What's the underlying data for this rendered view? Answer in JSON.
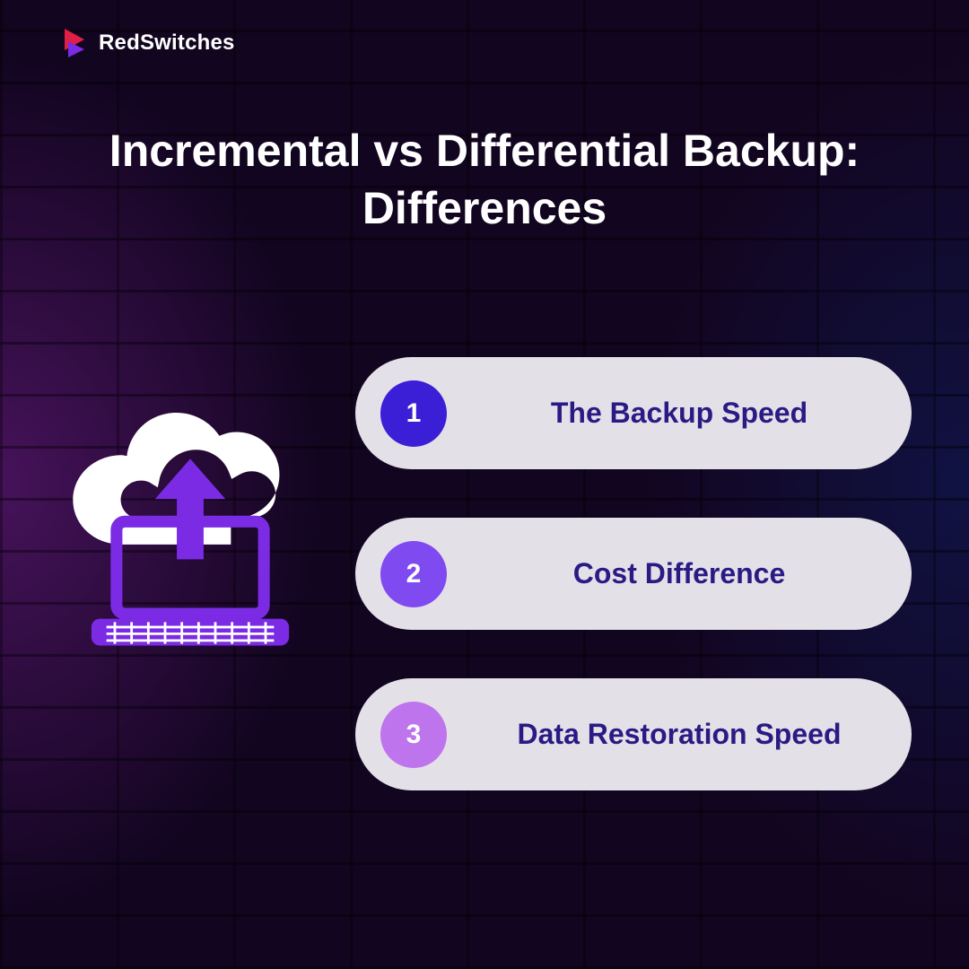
{
  "brand": {
    "name": "RedSwitches",
    "accent": "#e01f46"
  },
  "title": "Incremental vs Differential Backup: Differences",
  "items": [
    {
      "num": "1",
      "label": "The Backup Speed",
      "badge_color": "#3A1FD6"
    },
    {
      "num": "2",
      "label": "Cost Difference",
      "badge_color": "#7F4AF0"
    },
    {
      "num": "3",
      "label": "Data Restoration Speed",
      "badge_color": "#BE74EC"
    }
  ],
  "colors": {
    "pill_bg": "#E4E0E8",
    "pill_text": "#2A1B84",
    "illus_purple": "#7A2BE3",
    "illus_white": "#FFFFFF"
  }
}
